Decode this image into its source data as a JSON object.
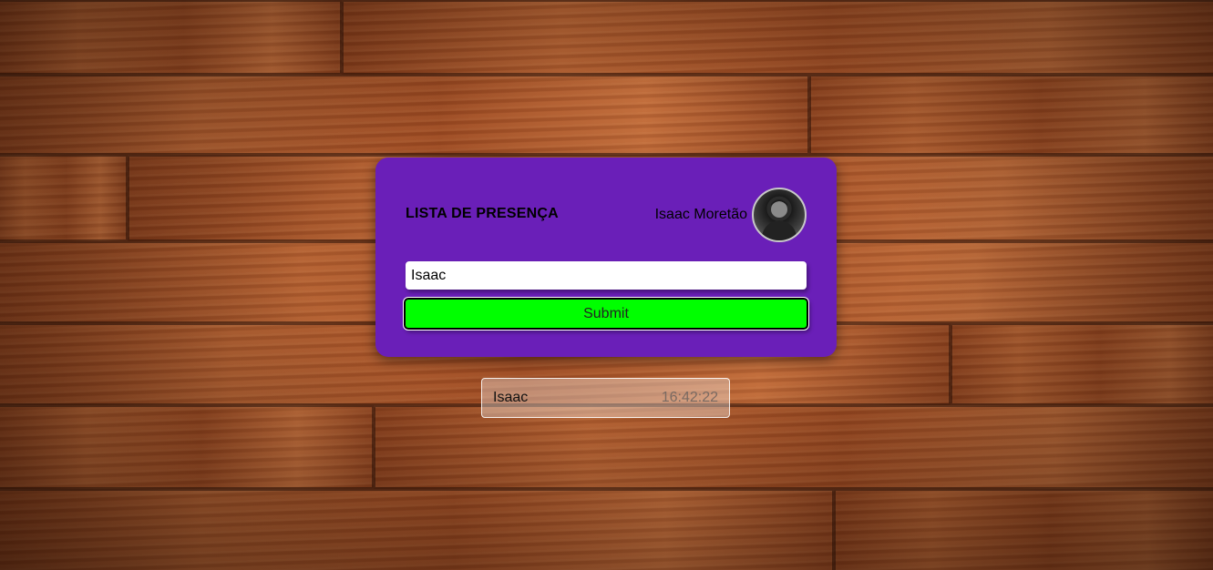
{
  "card": {
    "title": "LISTA DE PRESENÇA",
    "user_name": "Isaac Moretão",
    "avatar_icon": "user-avatar-photo",
    "input_value": "Isaac",
    "input_placeholder": "",
    "submit_label": "Submit"
  },
  "entries": [
    {
      "name": "Isaac",
      "time": "16:42:22"
    }
  ],
  "colors": {
    "card_background": "#6a1fb8",
    "submit_background": "#00ff00",
    "wood_base": "#9c4a22"
  }
}
